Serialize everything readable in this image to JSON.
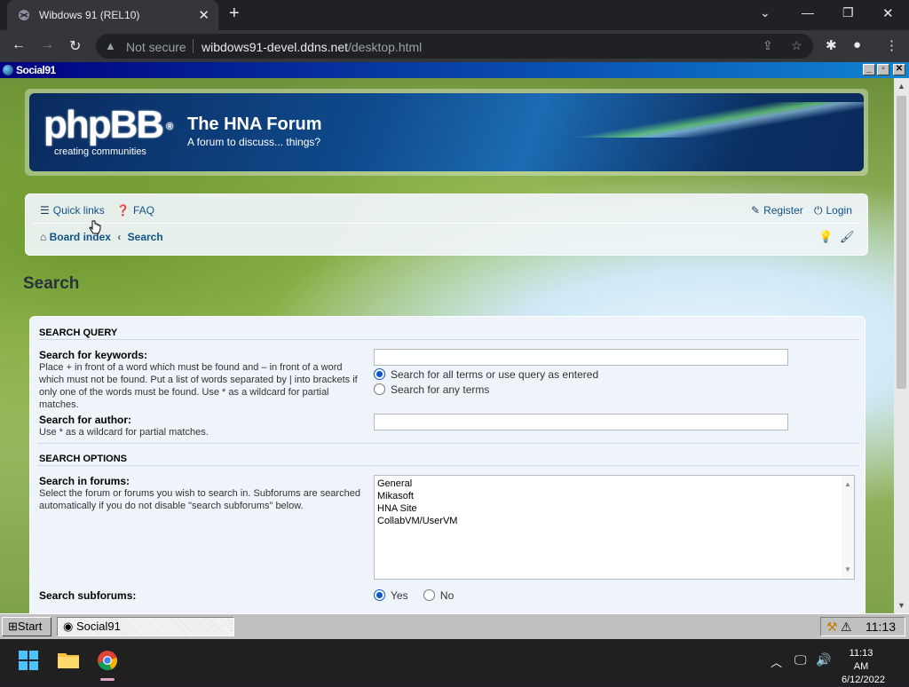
{
  "browser": {
    "tab_title": "Wibdows 91 (REL10)",
    "security_label": "Not secure",
    "url_host": "wibdows91-devel.ddns.net",
    "url_path": "/desktop.html"
  },
  "window": {
    "title": "Social91",
    "buttons": {
      "minimize": "_",
      "maximize": "▫",
      "close": "✕"
    }
  },
  "forum": {
    "logo": "phpBB",
    "logo_reg": "®",
    "logo_sub": "creating communities",
    "title": "The HNA Forum",
    "description": "A forum to discuss... things?",
    "nav": {
      "quick_links": "Quick links",
      "faq": "FAQ",
      "register": "Register",
      "login": "Login",
      "board_index": "Board index",
      "crumb_sep": "‹",
      "current": "Search"
    },
    "page_title": "Search"
  },
  "search_form": {
    "query_section": "SEARCH QUERY",
    "keywords_label": "Search for keywords:",
    "keywords_explain": "Place + in front of a word which must be found and – in front of a word which must not be found. Put a list of words separated by | into brackets if only one of the words must be found. Use * as a wildcard for partial matches.",
    "keywords_value": "",
    "terms_all": "Search for all terms or use query as entered",
    "terms_any": "Search for any terms",
    "author_label": "Search for author:",
    "author_explain": "Use * as a wildcard for partial matches.",
    "author_value": "",
    "options_section": "SEARCH OPTIONS",
    "forums_label": "Search in forums:",
    "forums_explain": "Select the forum or forums you wish to search in. Subforums are searched automatically if you do not disable \"search subforums\" below.",
    "forums": [
      "General",
      "Mikasoft",
      "HNA Site",
      "CollabVM/UserVM"
    ],
    "subforums_label": "Search subforums:",
    "subforums_yes": "Yes",
    "subforums_no": "No"
  },
  "taskbar9x": {
    "start": "Start",
    "task_social": "Social91",
    "time": "11:13"
  },
  "taskbar11": {
    "time": "11:13 AM",
    "date": "6/12/2022"
  }
}
